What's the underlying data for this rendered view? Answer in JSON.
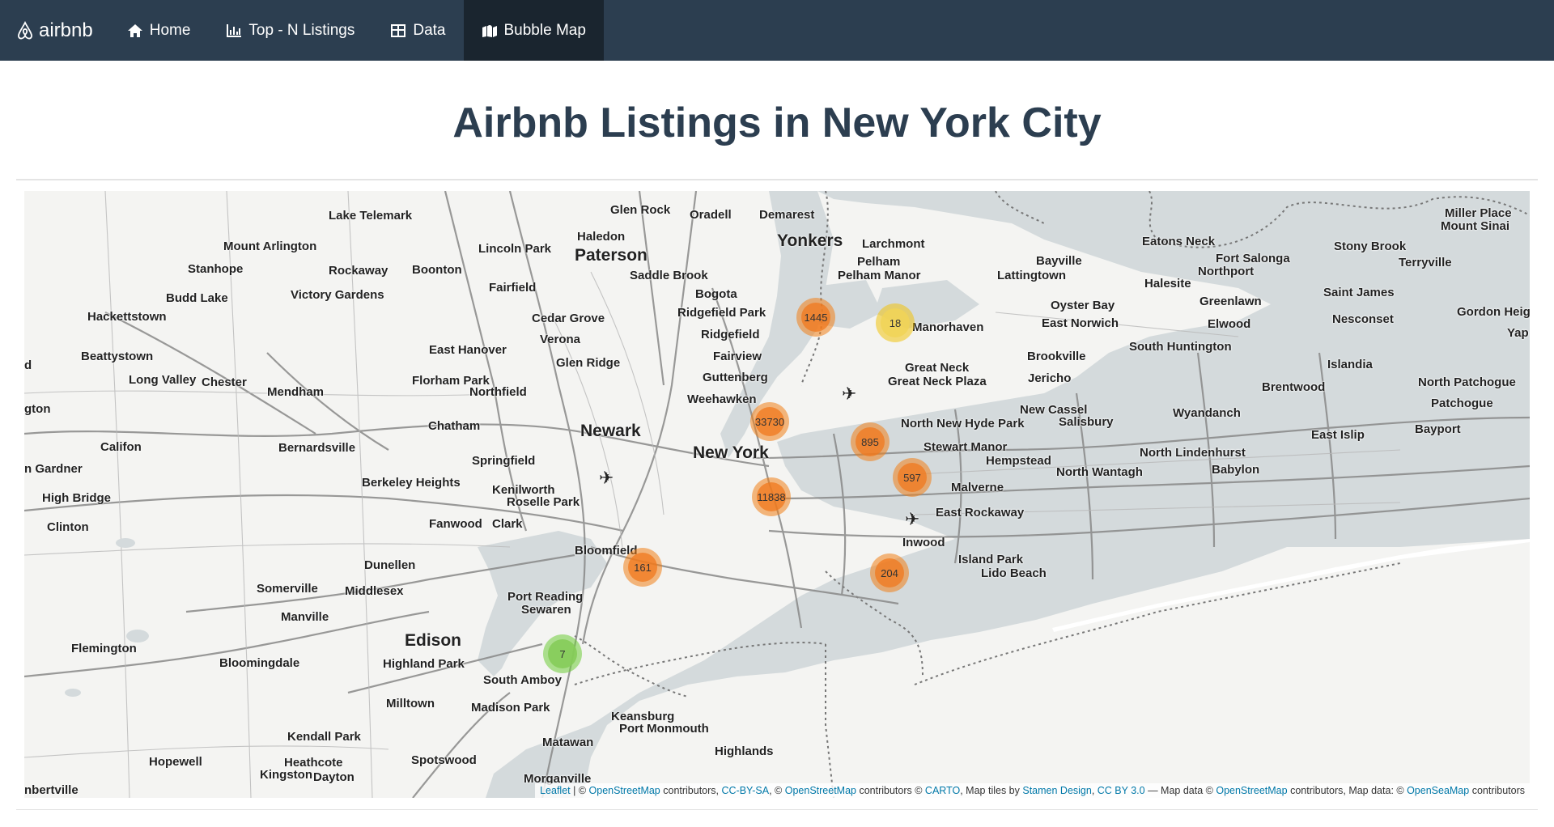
{
  "navbar": {
    "brand": "airbnb",
    "items": [
      {
        "label": "Home",
        "icon": "home-icon"
      },
      {
        "label": "Top - N Listings",
        "icon": "bar-chart-icon"
      },
      {
        "label": "Data",
        "icon": "table-icon"
      },
      {
        "label": "Bubble Map",
        "icon": "map-icon",
        "active": true
      }
    ]
  },
  "page": {
    "title": "Airbnb Listings in New York City"
  },
  "map": {
    "clusters": [
      {
        "count": "1445",
        "color": "orange"
      },
      {
        "count": "18",
        "color": "yellow"
      },
      {
        "count": "33730",
        "color": "orange"
      },
      {
        "count": "895",
        "color": "orange"
      },
      {
        "count": "597",
        "color": "orange"
      },
      {
        "count": "11838",
        "color": "orange"
      },
      {
        "count": "161",
        "color": "orange"
      },
      {
        "count": "204",
        "color": "orange"
      },
      {
        "count": "7",
        "color": "green"
      }
    ],
    "places": [
      "Lake Telemark",
      "Glen Rock",
      "Oradell",
      "Demarest",
      "Haledon",
      "Yonkers",
      "Larchmont",
      "Miller Place",
      "Mount Sinai",
      "Mount Arlington",
      "Lincoln Park",
      "Paterson",
      "Pelham",
      "Pelham Manor",
      "Eatons Neck",
      "Stony Brook",
      "Bayville",
      "Lattingtown",
      "Fort Salonga",
      "Northport",
      "Terryville",
      "Stanhope",
      "Rockaway",
      "Boonton",
      "Saddle Brook",
      "Halesite",
      "Budd Lake",
      "Victory Gardens",
      "Fairfield",
      "Bogota",
      "Oyster Bay",
      "Greenlawn",
      "Saint James",
      "Hackettstown",
      "Cedar Grove",
      "Ridgefield Park",
      "East Norwich",
      "Elwood",
      "Nesconset",
      "Gordon Heigh",
      "Manorhaven",
      "Verona",
      "Ridgefield",
      "Yap",
      "East Hanover",
      "Fairview",
      "Brookville",
      "South Huntington",
      "Beattystown",
      "Glen Ridge",
      "Great Neck",
      "Islandia",
      "Long Valley",
      "Chester",
      "Guttenberg",
      "Jericho",
      "Florham Park",
      "Great Neck Plaza",
      "North Patchogue",
      "Mendham",
      "Northfield",
      "Weehawken",
      "Brentwood",
      "Patchogue",
      "New Cassel",
      "Wyandanch",
      "Salisbury",
      "Chatham",
      "Newark",
      "North New Hyde Park",
      "Bayport",
      "East Islip",
      "Califon",
      "Bernardsville",
      "Stewart Manor",
      "New York",
      "North Lindenhurst",
      "Springfield",
      "Hempstead",
      "Babylon",
      "North Wantagh",
      "n Gardner",
      "Berkeley Heights",
      "Malverne",
      "Kenilworth",
      "High Bridge",
      "Roselle Park",
      "East Rockaway",
      "Fanwood",
      "Clark",
      "Clinton",
      "Inwood",
      "Bloomfield",
      "Island Park",
      "Lido Beach",
      "Dunellen",
      "Somerville",
      "Middlesex",
      "Port Reading",
      "Sewaren",
      "Manville",
      "Edison",
      "Flemington",
      "Highland Park",
      "Bloomingdale",
      "South Amboy",
      "Milltown",
      "Madison Park",
      "Keansburg",
      "Port Monmouth",
      "Kendall Park",
      "Matawan",
      "Highlands",
      "Hopewell",
      "Heathcote",
      "Spotswood",
      "Kingston",
      "Dayton",
      "Morganville",
      "nbertville",
      "d",
      "gton"
    ],
    "attribution": {
      "leaflet": "Leaflet",
      "sep1": " | © ",
      "osm1": "OpenStreetMap",
      "t1": " contributors, ",
      "ccbysa": "CC-BY-SA",
      "t2": ", © ",
      "osm2": "OpenStreetMap",
      "t3": " contributors © ",
      "carto": "CARTO",
      "t4": ", Map tiles by ",
      "stamen": "Stamen Design",
      "t5": ", ",
      "ccby": "CC BY 3.0",
      "t6": " — Map data © ",
      "osm3": "OpenStreetMap",
      "t7": " contributors, Map data: © ",
      "openseamap": "OpenSeaMap",
      "t8": " contributors"
    }
  }
}
